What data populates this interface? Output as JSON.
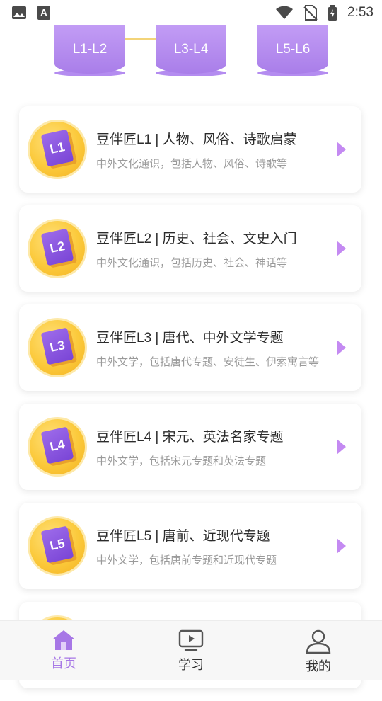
{
  "status_bar": {
    "time": "2:53",
    "icons": [
      "image-icon",
      "font-icon",
      "wifi-icon",
      "no-sim-icon",
      "battery-charging-icon"
    ]
  },
  "levels": [
    {
      "label": "L1-L2"
    },
    {
      "label": "L3-L4"
    },
    {
      "label": "L5-L6"
    }
  ],
  "courses": [
    {
      "badge": "L1",
      "title": "豆伴匠L1 | 人物、风俗、诗歌启蒙",
      "desc": "中外文化通识，包括人物、风俗、诗歌等"
    },
    {
      "badge": "L2",
      "title": "豆伴匠L2 | 历史、社会、文史入门",
      "desc": "中外文化通识，包括历史、社会、神话等"
    },
    {
      "badge": "L3",
      "title": "豆伴匠L3 | 唐代、中外文学专题",
      "desc": "中外文学，包括唐代专题、安徒生、伊索寓言等"
    },
    {
      "badge": "L4",
      "title": "豆伴匠L4 | 宋元、英法名家专题",
      "desc": "中外文学，包括宋元专题和英法专题"
    },
    {
      "badge": "L5",
      "title": "豆伴匠L5 | 唐前、近现代专题",
      "desc": "中外文学，包括唐前专题和近现代专题"
    }
  ],
  "tabs": [
    {
      "label": "首页",
      "icon": "home-icon",
      "active": true
    },
    {
      "label": "学习",
      "icon": "play-screen-icon",
      "active": false
    },
    {
      "label": "我的",
      "icon": "user-icon",
      "active": false
    }
  ],
  "colors": {
    "accent": "#a777e6",
    "chevron": "#c48af2",
    "badge_gold": "#fbc93a",
    "pill": "#b48cf0"
  }
}
